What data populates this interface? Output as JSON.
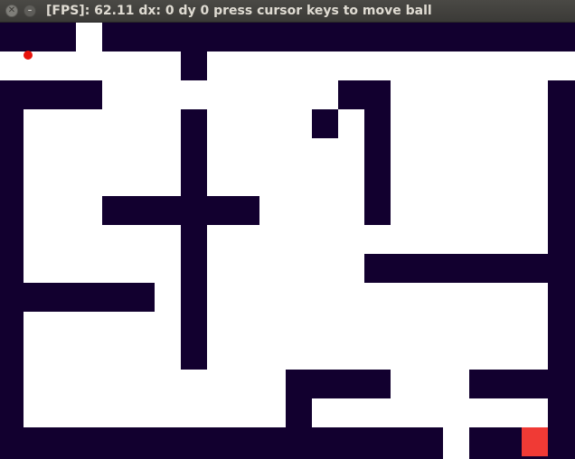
{
  "window": {
    "title": "[FPS]: 62.11 dx: 0 dy 0 press cursor keys to move ball",
    "close_glyph": "✕",
    "minimize_glyph": "–"
  },
  "game": {
    "wall_color": "#12002f",
    "background_color": "#ffffff",
    "ball_color": "#e8120c",
    "goal_color": "#f03a35",
    "icons": {
      "ball": "ball",
      "goal": "goal-square"
    }
  }
}
